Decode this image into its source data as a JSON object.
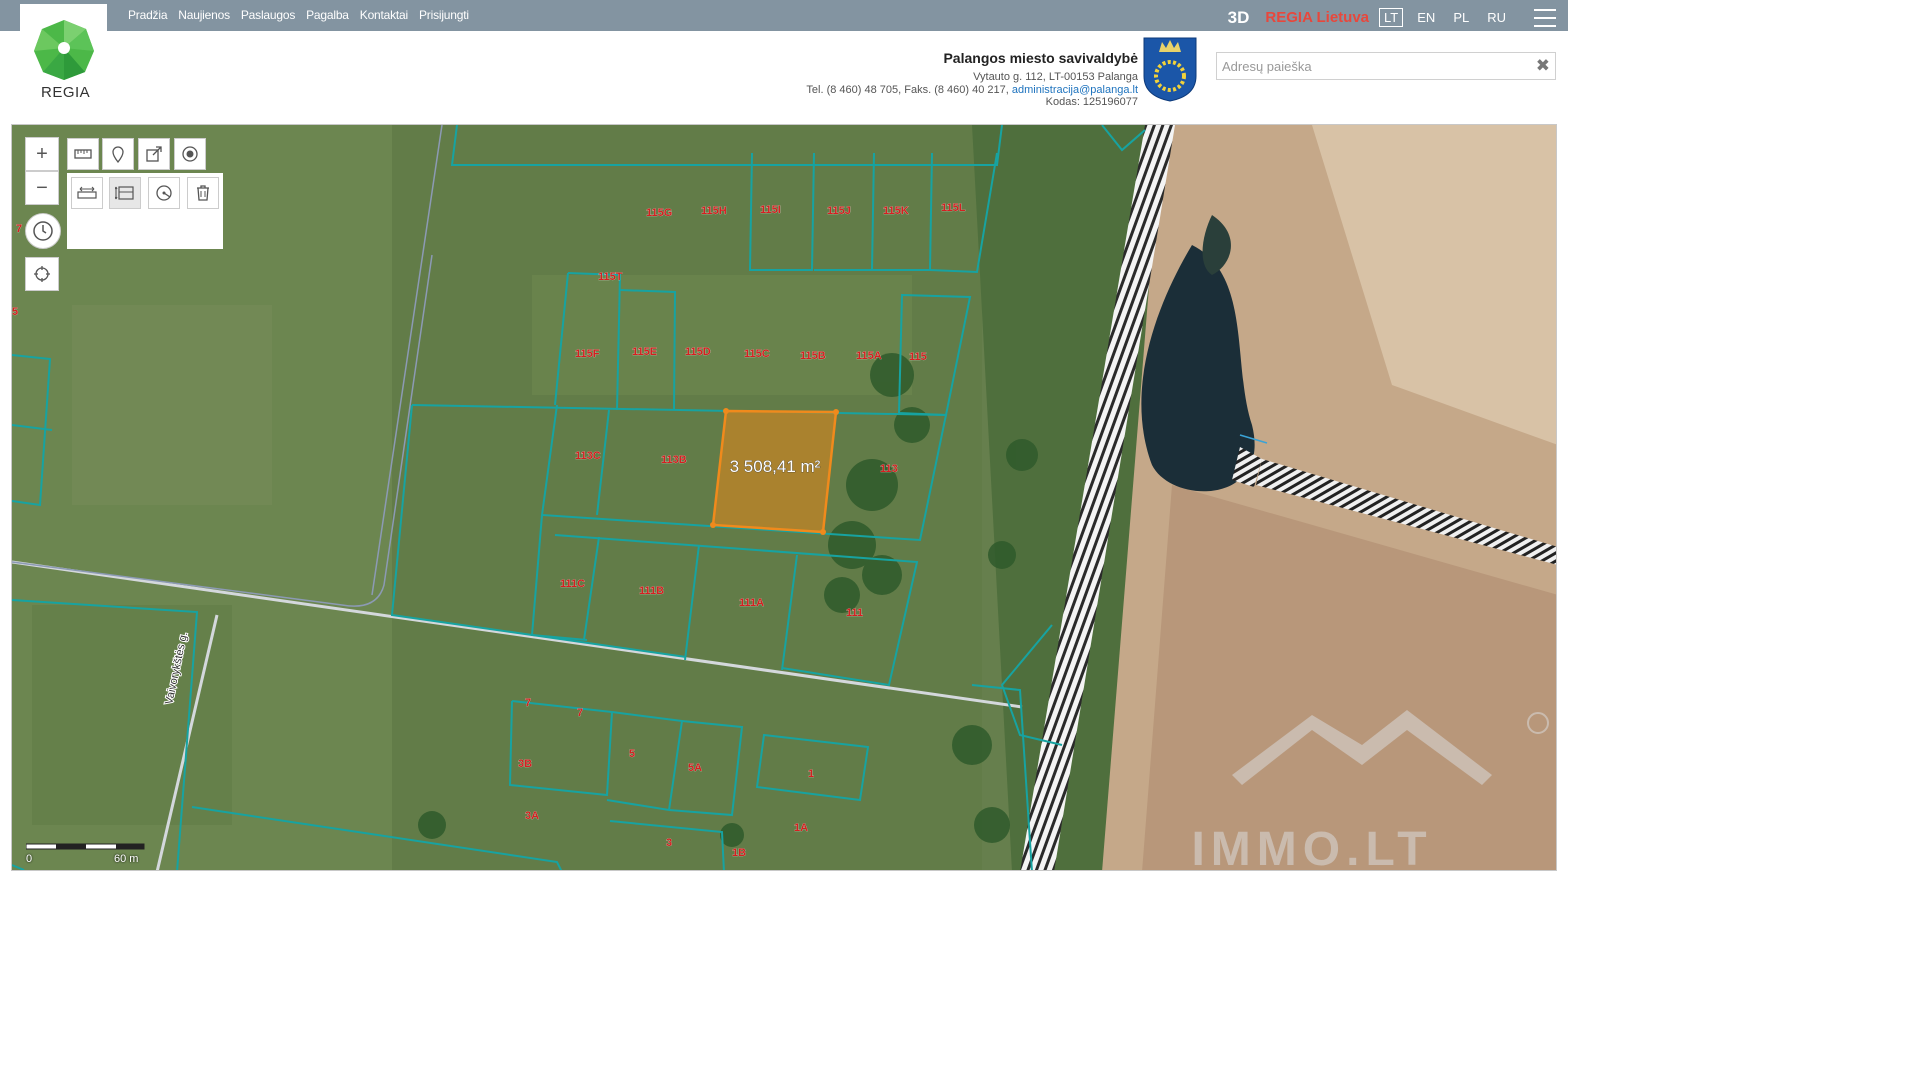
{
  "nav": [
    "Pradžia",
    "Naujienos",
    "Paslaugos",
    "Pagalba",
    "Kontaktai",
    "Prisijungti"
  ],
  "header": {
    "btn_3d": "3D",
    "regia_lietuva": "REGIA Lietuva",
    "languages": [
      "LT",
      "EN",
      "PL",
      "RU"
    ],
    "active_language": "LT",
    "logo_text": "REGIA",
    "menu_icon": "hamburger-icon"
  },
  "municipality": {
    "name": "Palangos miesto savivaldybė",
    "address": "Vytauto g. 112, LT-00153 Palanga",
    "phones": "Tel. (8 460) 48 705, Faks. (8 460) 40 217,",
    "email": "administracija@palanga.lt",
    "code": "Kodas: 125196077"
  },
  "search": {
    "placeholder": "Adresų paieška",
    "clear_icon": "close-icon"
  },
  "map": {
    "measured_area": "3 508,41 m²",
    "street_name": "Vaivorykštės g.",
    "parcel_labels": [
      "115G",
      "115H",
      "115I",
      "115J",
      "115K",
      "115L",
      "115T",
      "115F",
      "115E",
      "115D",
      "115C",
      "115B",
      "115A",
      "115",
      "113C",
      "113B",
      "113",
      "111C",
      "111B",
      "111A",
      "111",
      "7",
      "7",
      "5",
      "5A",
      "3B",
      "3A",
      "3",
      "1",
      "1A",
      "1B",
      "7",
      "5"
    ],
    "scale": {
      "start": "0",
      "end": "60 m"
    },
    "watermark": "IMMO.LT",
    "colors": {
      "parcel_outline": "#17a3a1",
      "parcel_label": "#d42020",
      "measured_fill": "#e88a1c"
    }
  },
  "tools": {
    "zoom_in": "plus-icon",
    "zoom_out": "minus-icon",
    "history": "clock-icon",
    "locate": "crosshair-icon",
    "row1": [
      "ruler-icon",
      "marker-icon",
      "share-icon",
      "record-icon"
    ],
    "row2": [
      "measure-distance-icon",
      "measure-area-icon",
      "measure-circle-icon",
      "trash-icon"
    ]
  }
}
